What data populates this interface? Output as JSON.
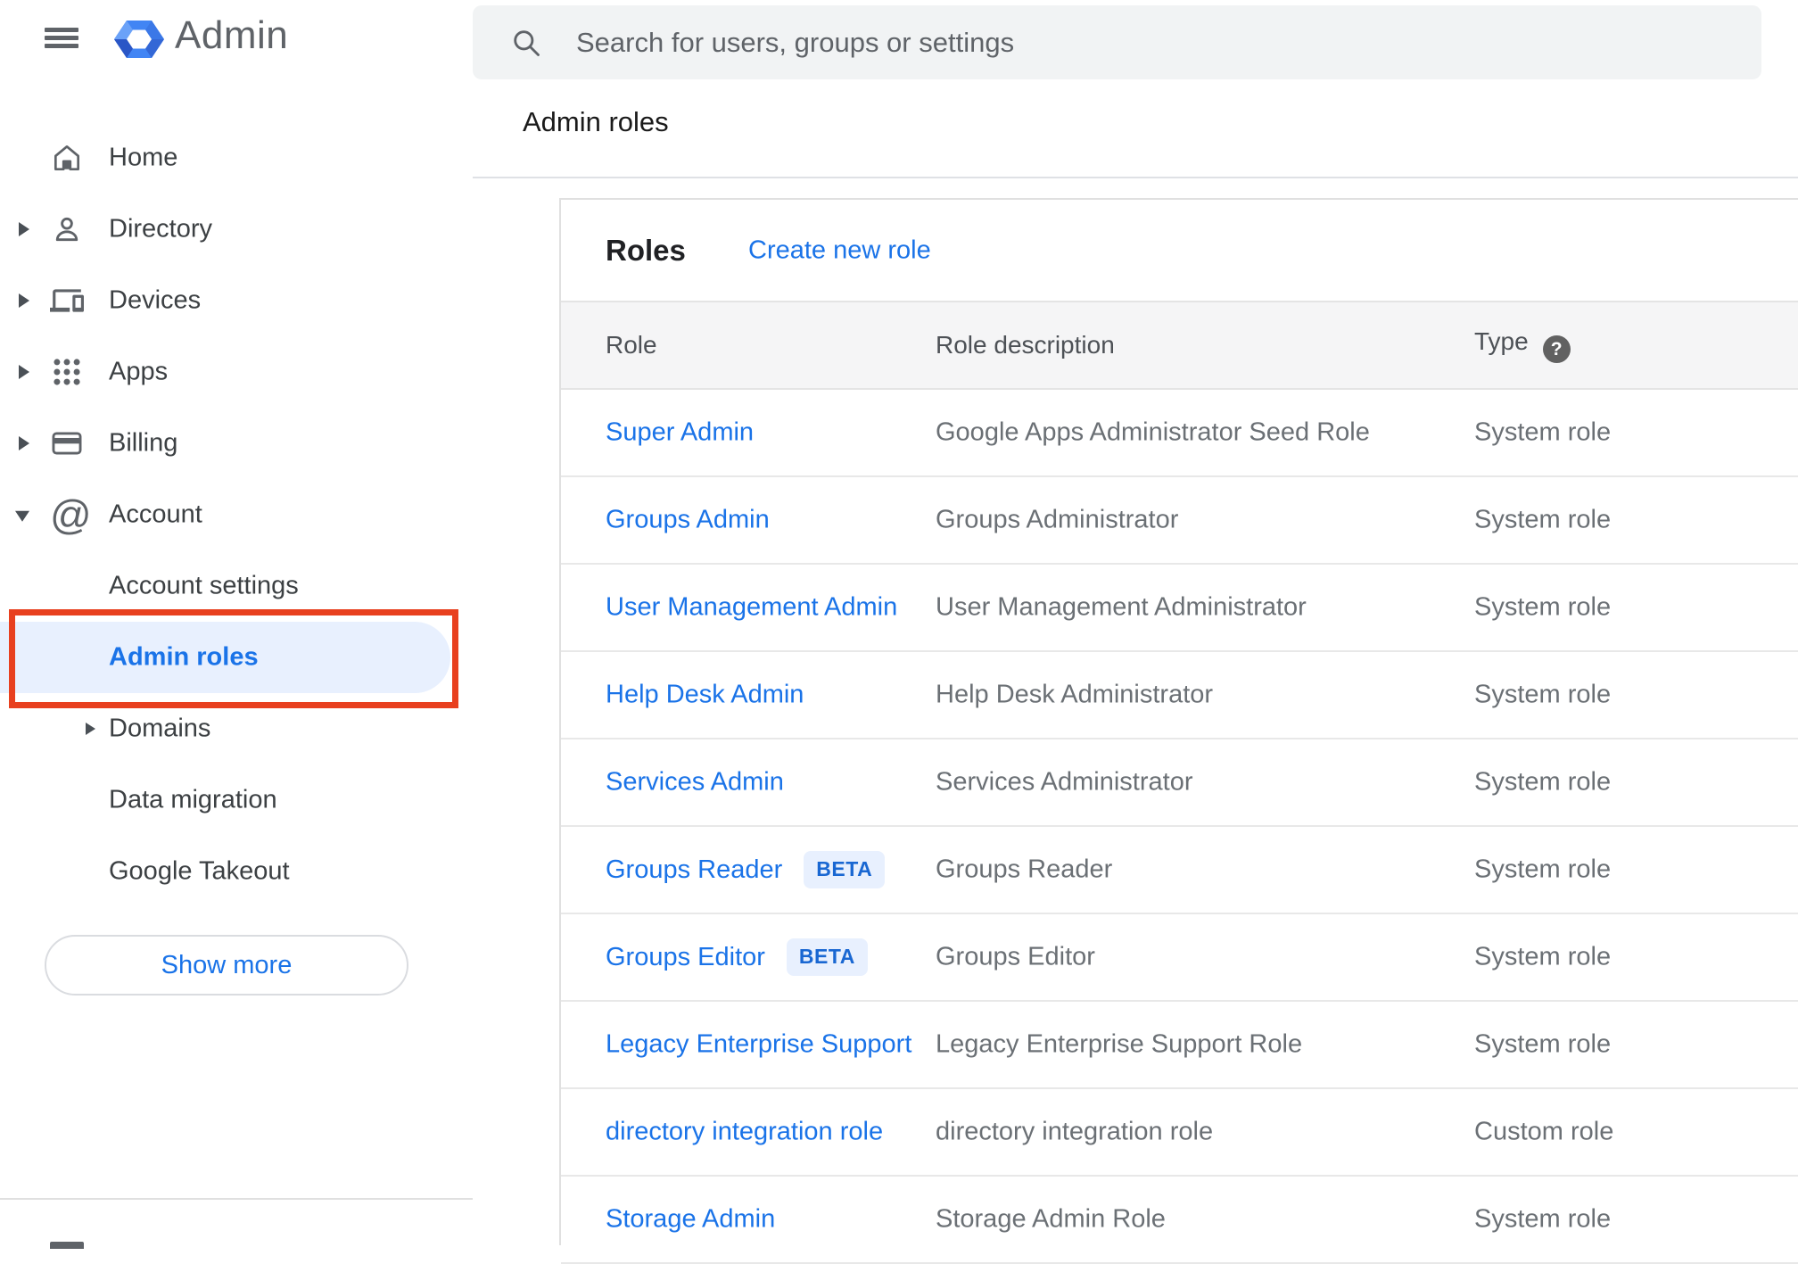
{
  "app": {
    "title": "Admin"
  },
  "search": {
    "placeholder": "Search for users, groups or settings"
  },
  "breadcrumb": "Admin roles",
  "sidebar": {
    "items": [
      {
        "label": "Home"
      },
      {
        "label": "Directory"
      },
      {
        "label": "Devices"
      },
      {
        "label": "Apps"
      },
      {
        "label": "Billing"
      },
      {
        "label": "Account"
      }
    ],
    "sub_items": [
      {
        "label": "Account settings"
      },
      {
        "label": "Admin roles",
        "active": true
      },
      {
        "label": "Domains"
      },
      {
        "label": "Data migration"
      },
      {
        "label": "Google Takeout"
      }
    ],
    "show_more_label": "Show more"
  },
  "panel": {
    "title": "Roles",
    "create_link": "Create new role",
    "columns": {
      "role": "Role",
      "description": "Role description",
      "type": "Type"
    },
    "help_glyph": "?",
    "rows": [
      {
        "role": "Super Admin",
        "description": "Google Apps Administrator Seed Role",
        "type": "System role"
      },
      {
        "role": "Groups Admin",
        "description": "Groups Administrator",
        "type": "System role"
      },
      {
        "role": "User Management Admin",
        "description": "User Management Administrator",
        "type": "System role"
      },
      {
        "role": "Help Desk Admin",
        "description": "Help Desk Administrator",
        "type": "System role"
      },
      {
        "role": "Services Admin",
        "description": "Services Administrator",
        "type": "System role"
      },
      {
        "role": "Groups Reader",
        "beta_label": "BETA",
        "description": "Groups Reader",
        "type": "System role"
      },
      {
        "role": "Groups Editor",
        "beta_label": "BETA",
        "description": "Groups Editor",
        "type": "System role"
      },
      {
        "role": "Legacy Enterprise Support",
        "description": "Legacy Enterprise Support Role",
        "type": "System role"
      },
      {
        "role": "directory integration role",
        "description": "directory integration role",
        "type": "Custom role"
      },
      {
        "role": "Storage Admin",
        "description": "Storage Admin Role",
        "type": "System role"
      }
    ]
  },
  "colors": {
    "accent_blue": "#1a73e8",
    "link_blue": "#1967d2",
    "annotation_red": "#e8401f",
    "active_item_bg": "#e8f0fe",
    "beta_badge_bg": "#e8f0fe",
    "header_row_bg": "#f5f5f6",
    "search_bg": "#f1f3f4",
    "icon_gray": "#5f6368"
  }
}
